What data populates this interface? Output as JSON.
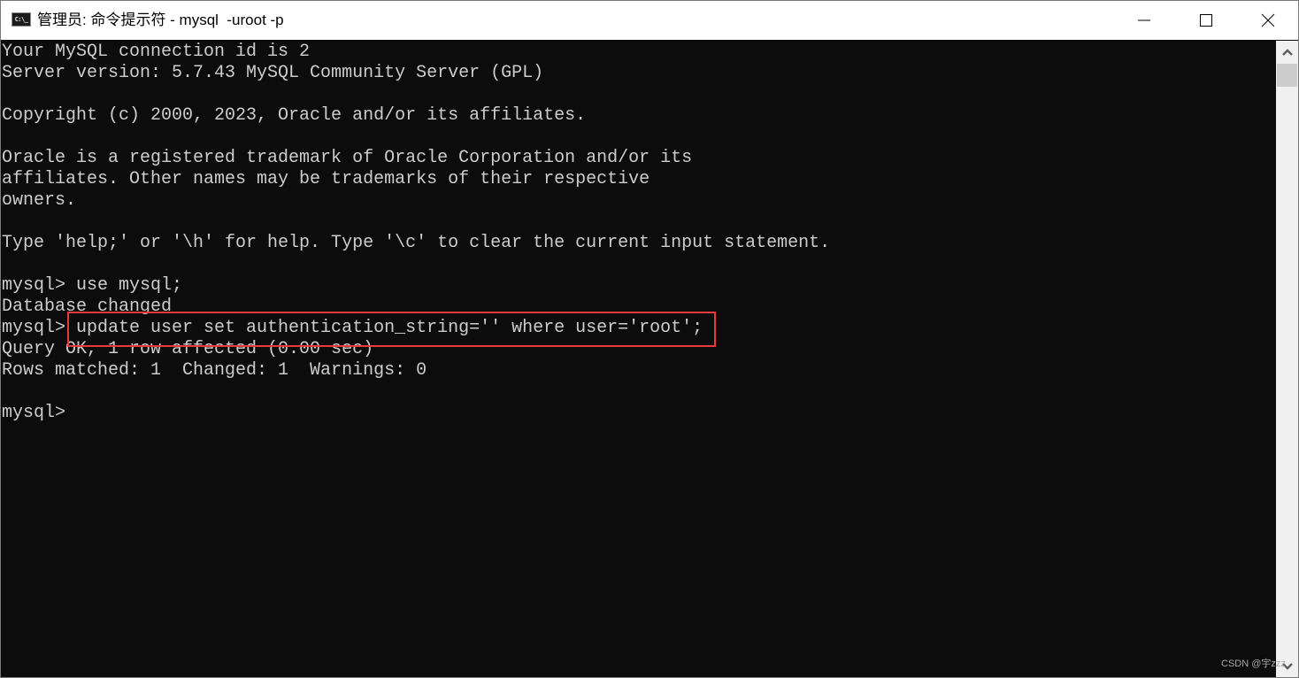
{
  "window": {
    "title": "管理员: 命令提示符 - mysql  -uroot -p",
    "app_icon_label": "C:\\_",
    "controls": {
      "minimize": "minimize-icon",
      "maximize": "maximize-icon",
      "close": "close-icon"
    }
  },
  "terminal": {
    "colors": {
      "background": "#0c0c0c",
      "foreground": "#cccccc",
      "highlight_border": "#e8393f"
    },
    "lines": [
      "Your MySQL connection id is 2",
      "Server version: 5.7.43 MySQL Community Server (GPL)",
      "",
      "Copyright (c) 2000, 2023, Oracle and/or its affiliates.",
      "",
      "Oracle is a registered trademark of Oracle Corporation and/or its",
      "affiliates. Other names may be trademarks of their respective",
      "owners.",
      "",
      "Type 'help;' or '\\h' for help. Type '\\c' to clear the current input statement.",
      "",
      "mysql> use mysql;",
      "Database changed",
      "mysql> update user set authentication_string='' where user='root';",
      "Query OK, 1 row affected (0.00 sec)",
      "Rows matched: 1  Changed: 1  Warnings: 0",
      "",
      "mysql>"
    ],
    "highlighted_command": "update user set authentication_string='' where user='root';"
  },
  "watermark": "CSDN @宇zzz"
}
